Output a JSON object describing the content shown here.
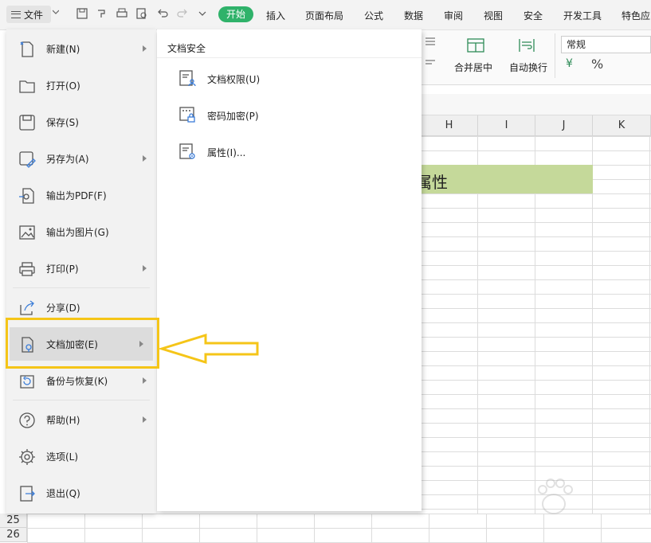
{
  "topbar": {
    "file_label": "文件",
    "tabs": [
      "开始",
      "插入",
      "页面布局",
      "公式",
      "数据",
      "审阅",
      "视图",
      "安全",
      "开发工具",
      "特色应"
    ]
  },
  "ribbon": {
    "merge_label": "合并居中",
    "wrap_label": "自动换行",
    "number_format": "常规",
    "percent_symbol": "%",
    "currency_symbol": "¥"
  },
  "sheet": {
    "columns": [
      "H",
      "I",
      "J",
      "K"
    ],
    "merged_cell_text": "属性",
    "row_numbers": [
      "25",
      "26"
    ],
    "header_color": "#efefef",
    "merged_fill": "#c5d99a"
  },
  "file_menu": {
    "items": [
      {
        "label": "新建(N)",
        "icon": "new-file-icon",
        "submenu": true
      },
      {
        "label": "打开(O)",
        "icon": "folder-icon",
        "submenu": false
      },
      {
        "label": "保存(S)",
        "icon": "save-icon",
        "submenu": false
      },
      {
        "label": "另存为(A)",
        "icon": "save-as-icon",
        "submenu": true
      },
      {
        "label": "输出为PDF(F)",
        "icon": "pdf-export-icon",
        "submenu": false
      },
      {
        "label": "输出为图片(G)",
        "icon": "image-export-icon",
        "submenu": false
      },
      {
        "label": "打印(P)",
        "icon": "printer-icon",
        "submenu": true
      },
      {
        "label": "分享(D)",
        "icon": "share-icon",
        "submenu": false
      },
      {
        "label": "文档加密(E)",
        "icon": "document-encrypt-icon",
        "submenu": true
      },
      {
        "label": "备份与恢复(K)",
        "icon": "backup-icon",
        "submenu": true
      },
      {
        "label": "帮助(H)",
        "icon": "help-icon",
        "submenu": true
      },
      {
        "label": "选项(L)",
        "icon": "gear-icon",
        "submenu": false
      },
      {
        "label": "退出(Q)",
        "icon": "exit-icon",
        "submenu": false
      }
    ],
    "active_item": "文档加密(E)"
  },
  "submenu": {
    "title": "文档安全",
    "items": [
      {
        "label": "文档权限(U)",
        "icon": "document-permission-icon"
      },
      {
        "label": "密码加密(P)",
        "icon": "password-lock-icon"
      },
      {
        "label": "属性(I)...",
        "icon": "properties-icon"
      }
    ]
  },
  "annotation": {
    "color": "#f5c518"
  },
  "colors": {
    "accent_green": "#2fb26a",
    "menu_bg": "#f2f2f2",
    "active_bg": "#dcdcdc"
  }
}
